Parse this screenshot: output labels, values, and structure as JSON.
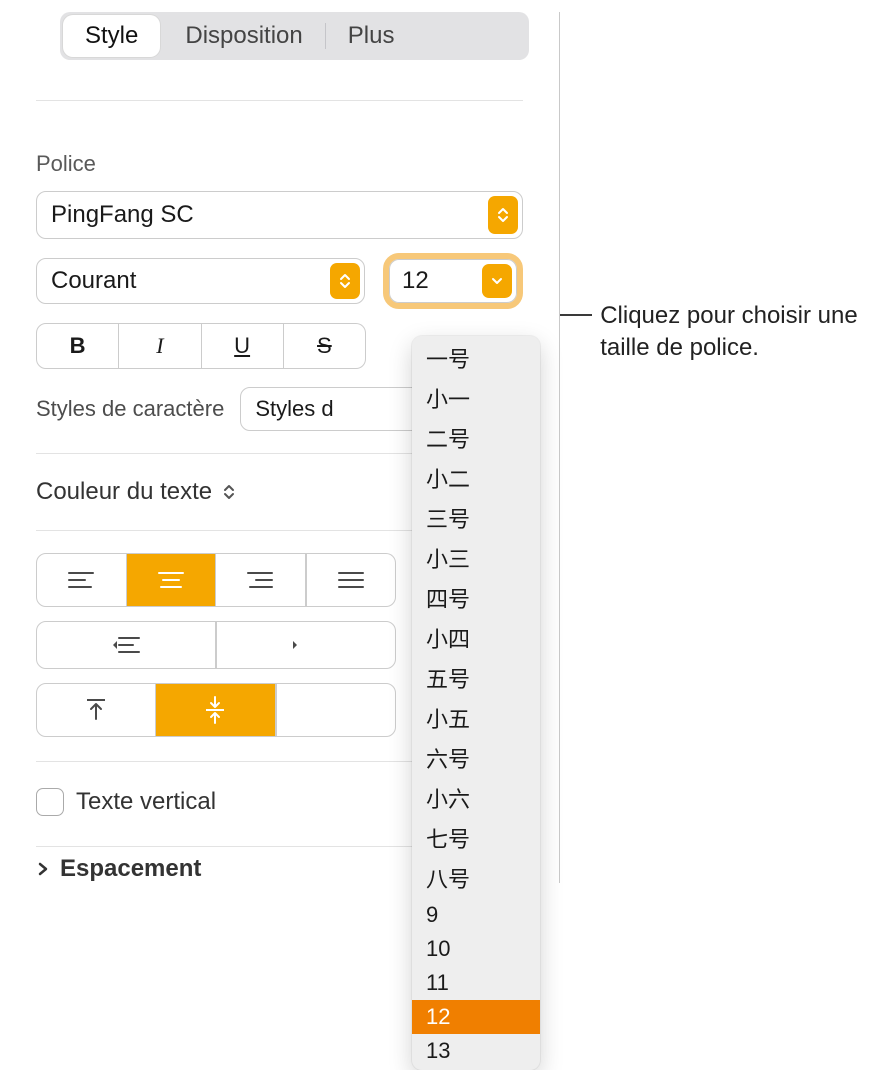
{
  "tabs": {
    "style": "Style",
    "disposition": "Disposition",
    "plus": "Plus"
  },
  "font": {
    "section_label": "Police",
    "family": "PingFang SC",
    "style": "Courant",
    "size": "12"
  },
  "format": {
    "bold": "B",
    "italic": "I",
    "underline": "U",
    "strike": "S"
  },
  "char_styles": {
    "label": "Styles de caractère",
    "button": "Styles d"
  },
  "text_color_label": "Couleur du texte",
  "vertical_text_label": "Texte vertical",
  "spacing_label": "Espacement",
  "size_menu": {
    "items": [
      "一号",
      "小一",
      "二号",
      "小二",
      "三号",
      "小三",
      "四号",
      "小四",
      "五号",
      "小五",
      "六号",
      "小六",
      "七号",
      "八号",
      "9",
      "10",
      "11",
      "12",
      "13"
    ],
    "selected": "12"
  },
  "callout": "Cliquez pour choisir une taille de police."
}
